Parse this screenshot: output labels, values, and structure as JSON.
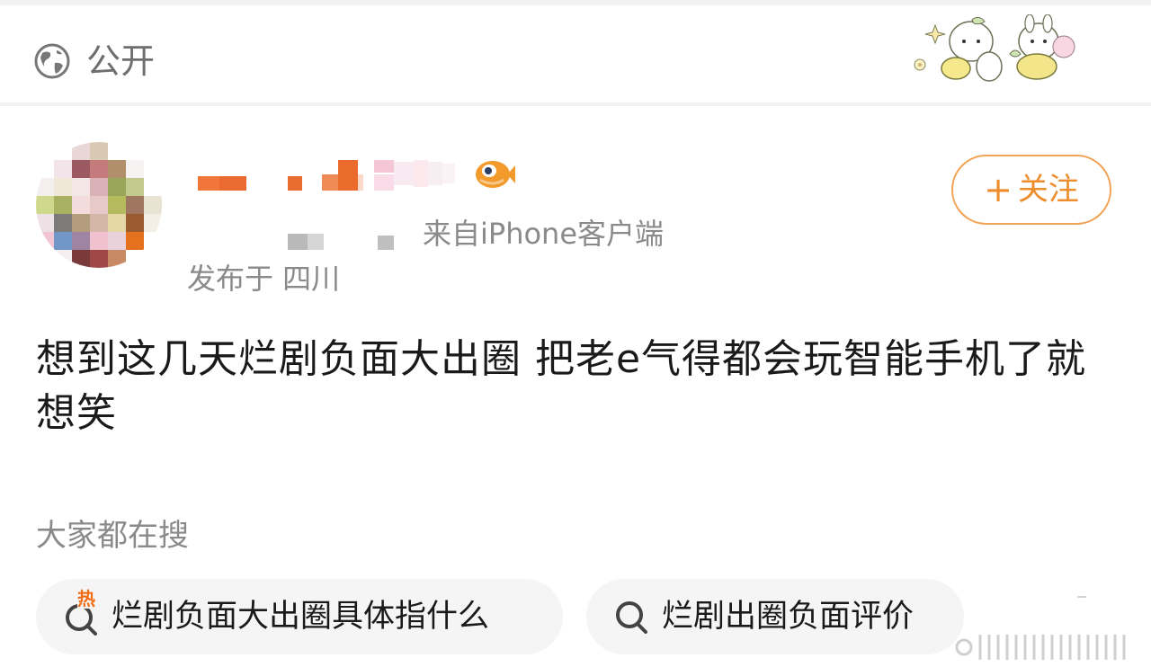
{
  "header": {
    "visibility_icon": "globe-icon",
    "visibility_label": "公开"
  },
  "post": {
    "follow_icon": "plus",
    "follow_label": "关注",
    "source_text": "来自iPhone客户端",
    "location_text": "发布于 四川",
    "body_text": "想到这几天烂剧负面大出圈 把老e气得都会玩智能手机了就想笑"
  },
  "search": {
    "title": "大家都在搜",
    "chips": [
      {
        "label": "烂剧负面大出圈具体指什么",
        "icon": "hot-search-icon",
        "badge": "热"
      },
      {
        "label": "烂剧出圈负面评价",
        "icon": "search-icon"
      }
    ]
  },
  "colors": {
    "accent": "#ee8d2c",
    "follow_border": "#f2a253",
    "meta_text": "#8a8a8a",
    "body_text": "#1a1a1a",
    "chip_bg": "#f5f5f5",
    "page_bg": "#f2f2f2"
  }
}
